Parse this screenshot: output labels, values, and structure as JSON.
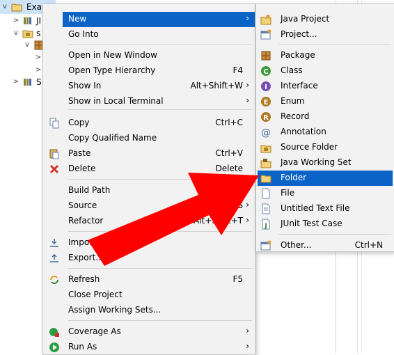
{
  "tree": {
    "root_label": "Exam",
    "items": [
      {
        "label": "JI"
      },
      {
        "label": "s"
      },
      {
        "label": "S"
      }
    ]
  },
  "context_menu": {
    "items": [
      {
        "label": "New",
        "shortcut": "",
        "submenu": true,
        "highlighted": true
      },
      {
        "label": "Go Into",
        "shortcut": ""
      },
      {
        "label": "Open in New Window",
        "shortcut": ""
      },
      {
        "label": "Open Type Hierarchy",
        "shortcut": "F4"
      },
      {
        "label": "Show In",
        "shortcut": "Alt+Shift+W",
        "submenu": true
      },
      {
        "label": "Show in Local Terminal",
        "shortcut": "",
        "submenu": true
      },
      {
        "label": "Copy",
        "shortcut": "Ctrl+C",
        "icon": "copy-icon"
      },
      {
        "label": "Copy Qualified Name",
        "shortcut": ""
      },
      {
        "label": "Paste",
        "shortcut": "Ctrl+V",
        "icon": "paste-icon"
      },
      {
        "label": "Delete",
        "shortcut": "Delete",
        "icon": "delete-icon"
      },
      {
        "label": "Build Path",
        "shortcut": "",
        "submenu": true
      },
      {
        "label": "Source",
        "shortcut": "Alt+Shift+S",
        "submenu": true
      },
      {
        "label": "Refactor",
        "shortcut": "Alt+Shift+T",
        "submenu": true
      },
      {
        "label": "Import...",
        "shortcut": "",
        "icon": "import-icon"
      },
      {
        "label": "Export...",
        "shortcut": "",
        "icon": "export-icon"
      },
      {
        "label": "Refresh",
        "shortcut": "F5",
        "icon": "refresh-icon"
      },
      {
        "label": "Close Project",
        "shortcut": ""
      },
      {
        "label": "Assign Working Sets...",
        "shortcut": ""
      },
      {
        "label": "Coverage As",
        "shortcut": "",
        "submenu": true,
        "icon": "coverage-icon"
      },
      {
        "label": "Run As",
        "shortcut": "",
        "submenu": true,
        "icon": "run-icon"
      }
    ]
  },
  "new_submenu": {
    "items": [
      {
        "label": "Java Project",
        "shortcut": "",
        "icon": "java-project-icon"
      },
      {
        "label": "Project...",
        "shortcut": "",
        "icon": "project-icon"
      },
      {
        "label": "Package",
        "shortcut": "",
        "icon": "package-icon"
      },
      {
        "label": "Class",
        "shortcut": "",
        "icon": "class-icon"
      },
      {
        "label": "Interface",
        "shortcut": "",
        "icon": "interface-icon"
      },
      {
        "label": "Enum",
        "shortcut": "",
        "icon": "enum-icon"
      },
      {
        "label": "Record",
        "shortcut": "",
        "icon": "record-icon"
      },
      {
        "label": "Annotation",
        "shortcut": "",
        "icon": "annotation-icon"
      },
      {
        "label": "Source Folder",
        "shortcut": "",
        "icon": "source-folder-icon"
      },
      {
        "label": "Java Working Set",
        "shortcut": "",
        "icon": "working-set-icon"
      },
      {
        "label": "Folder",
        "shortcut": "",
        "icon": "folder-icon",
        "highlighted": true
      },
      {
        "label": "File",
        "shortcut": "",
        "icon": "file-icon"
      },
      {
        "label": "Untitled Text File",
        "shortcut": "",
        "icon": "text-file-icon"
      },
      {
        "label": "JUnit Test Case",
        "shortcut": "",
        "icon": "junit-icon"
      },
      {
        "label": "Other...",
        "shortcut": "Ctrl+N",
        "icon": "other-icon"
      }
    ]
  },
  "colors": {
    "highlight": "#0a64c8",
    "annotation_arrow": "#ff0000"
  }
}
